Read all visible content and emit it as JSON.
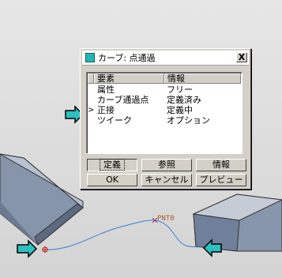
{
  "dialog": {
    "title": "カーブ: 点通過",
    "close_label": "X",
    "icon": "curve-tool-icon",
    "columns": {
      "element": "要素",
      "info": "情報"
    },
    "rows": [
      {
        "marker": "",
        "element": "属性",
        "info": "フリー"
      },
      {
        "marker": "",
        "element": "カーブ通過点",
        "info": "定義済み"
      },
      {
        "marker": ">",
        "element": "正接",
        "info": "定義中"
      },
      {
        "marker": "",
        "element": "ツイーク",
        "info": "オプション"
      }
    ],
    "buttons": {
      "define": "定義",
      "reference": "参照",
      "info": "情報",
      "ok": "OK",
      "cancel": "キャンセル",
      "preview": "プレビュー"
    }
  },
  "scene": {
    "point_label": "PNT0",
    "curve_color": "#3a7fd0",
    "callout_color": "#2ec0c0",
    "solid_color": "#7a8aa0"
  }
}
